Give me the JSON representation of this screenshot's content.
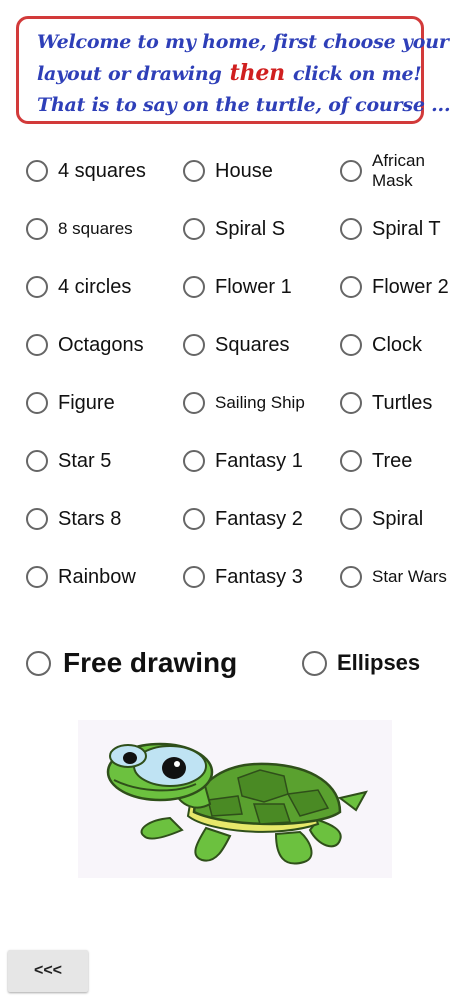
{
  "banner": {
    "line1": "Welcome to my home, first choose your",
    "line2_before": "layout or drawing",
    "line2_highlight": "then",
    "line2_after": "click on me!",
    "line3": "That is to say on the turtle, of course ..."
  },
  "options": {
    "r1": [
      "4 squares",
      "House",
      "African Mask"
    ],
    "r2": [
      "8 squares",
      "Spiral S",
      "Spiral T"
    ],
    "r3": [
      "4 circles",
      "Flower 1",
      "Flower 2"
    ],
    "r4": [
      "Octagons",
      "Squares",
      "Clock"
    ],
    "r5": [
      "Figure",
      "Sailing Ship",
      "Turtles"
    ],
    "r6": [
      "Star 5",
      "Fantasy 1",
      "Tree"
    ],
    "r7": [
      "Stars 8",
      "Fantasy 2",
      "Spiral"
    ],
    "r8": [
      "Rainbow",
      "Fantasy 3",
      "Star Wars"
    ]
  },
  "free_drawing_label": "Free drawing",
  "ellipses_label": "Ellipses",
  "back_button_label": "<<<",
  "colors": {
    "banner_text": "#2e3fb8",
    "banner_highlight": "#d01f1f",
    "banner_border": "#d23a3a",
    "radio_border": "#666666",
    "turtle_green": "#6cc13f",
    "turtle_shell": "#4f9a2b"
  }
}
